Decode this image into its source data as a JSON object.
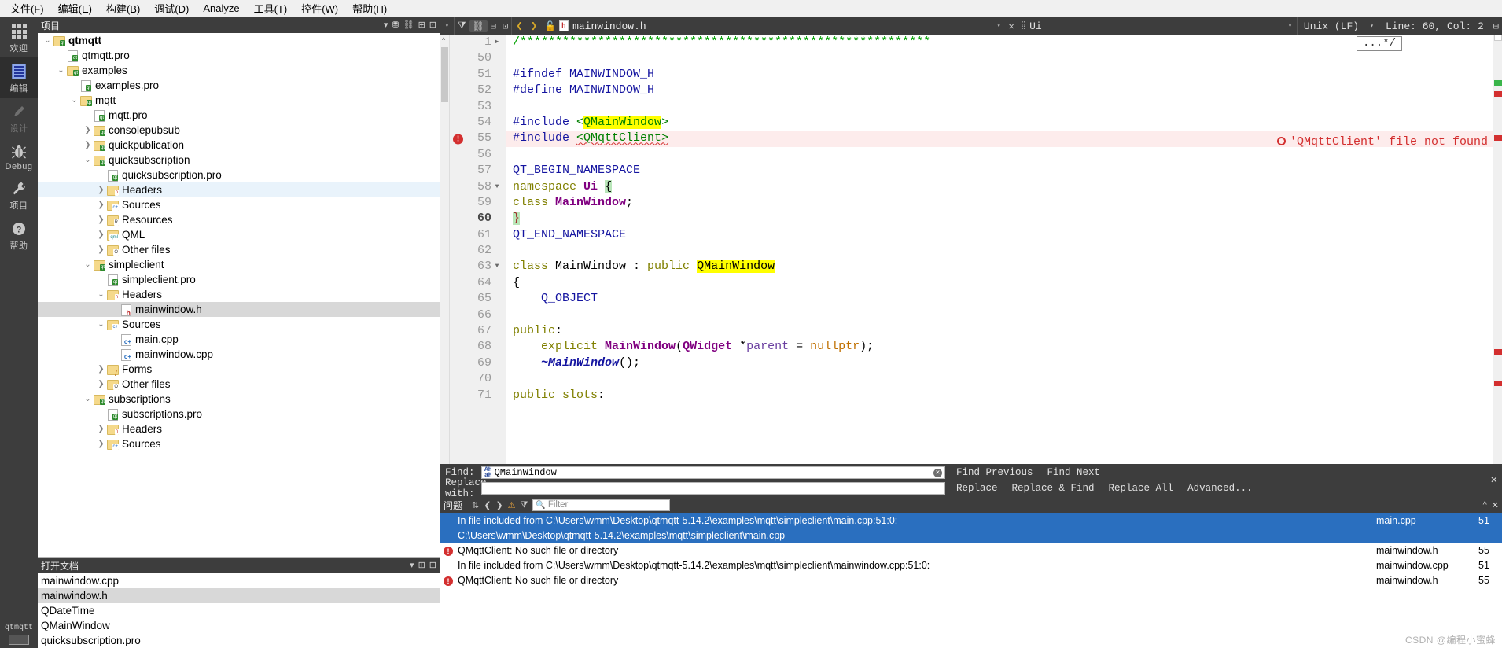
{
  "menubar": [
    {
      "label": "文件(F)"
    },
    {
      "label": "编辑(E)"
    },
    {
      "label": "构建(B)"
    },
    {
      "label": "调试(D)"
    },
    {
      "label": "Analyze"
    },
    {
      "label": "工具(T)"
    },
    {
      "label": "控件(W)"
    },
    {
      "label": "帮助(H)"
    }
  ],
  "modebar": {
    "items": [
      {
        "label": "欢迎",
        "icon": "grid-icon",
        "state": "normal"
      },
      {
        "label": "编辑",
        "icon": "document-icon",
        "state": "selected"
      },
      {
        "label": "设计",
        "icon": "pencil-icon",
        "state": "disabled"
      },
      {
        "label": "Debug",
        "icon": "bug-icon",
        "state": "normal"
      },
      {
        "label": "项目",
        "icon": "wrench-icon",
        "state": "normal"
      },
      {
        "label": "帮助",
        "icon": "question-icon",
        "state": "normal"
      }
    ],
    "project_name": "qtmqtt"
  },
  "project_panel": {
    "title": "项目",
    "tree": [
      {
        "indent": 0,
        "arrow": "down",
        "icon": "folder",
        "tag": "qt",
        "label": "qtmqtt",
        "bold": true,
        "sel": ""
      },
      {
        "indent": 1,
        "arrow": "none",
        "icon": "file",
        "tag": "qt",
        "label": "qtmqtt.pro",
        "bold": false,
        "sel": ""
      },
      {
        "indent": 1,
        "arrow": "down",
        "icon": "folder",
        "tag": "qt",
        "label": "examples",
        "bold": false,
        "sel": ""
      },
      {
        "indent": 2,
        "arrow": "none",
        "icon": "file",
        "tag": "qt",
        "label": "examples.pro",
        "bold": false,
        "sel": ""
      },
      {
        "indent": 2,
        "arrow": "down",
        "icon": "folder",
        "tag": "qt",
        "label": "mqtt",
        "bold": false,
        "sel": ""
      },
      {
        "indent": 3,
        "arrow": "none",
        "icon": "file",
        "tag": "qt",
        "label": "mqtt.pro",
        "bold": false,
        "sel": ""
      },
      {
        "indent": 3,
        "arrow": "right",
        "icon": "folder",
        "tag": "qt",
        "label": "consolepubsub",
        "bold": false,
        "sel": ""
      },
      {
        "indent": 3,
        "arrow": "right",
        "icon": "folder",
        "tag": "qt",
        "label": "quickpublication",
        "bold": false,
        "sel": ""
      },
      {
        "indent": 3,
        "arrow": "down",
        "icon": "folder",
        "tag": "qt",
        "label": "quicksubscription",
        "bold": false,
        "sel": ""
      },
      {
        "indent": 4,
        "arrow": "none",
        "icon": "file",
        "tag": "qt",
        "label": "quicksubscription.pro",
        "bold": false,
        "sel": ""
      },
      {
        "indent": 4,
        "arrow": "right",
        "icon": "folder-h",
        "tag": "h",
        "label": "Headers",
        "bold": false,
        "sel": "blue"
      },
      {
        "indent": 4,
        "arrow": "right",
        "icon": "folder-cpp",
        "tag": "c+",
        "label": "Sources",
        "bold": false,
        "sel": ""
      },
      {
        "indent": 4,
        "arrow": "right",
        "icon": "folder-res",
        "tag": "R",
        "label": "Resources",
        "bold": false,
        "sel": ""
      },
      {
        "indent": 4,
        "arrow": "right",
        "icon": "folder-qml",
        "tag": "qml",
        "label": "QML",
        "bold": false,
        "sel": ""
      },
      {
        "indent": 4,
        "arrow": "right",
        "icon": "folder-other",
        "tag": "O",
        "label": "Other files",
        "bold": false,
        "sel": ""
      },
      {
        "indent": 3,
        "arrow": "down",
        "icon": "folder",
        "tag": "qt",
        "label": "simpleclient",
        "bold": false,
        "sel": ""
      },
      {
        "indent": 4,
        "arrow": "none",
        "icon": "file",
        "tag": "qt",
        "label": "simpleclient.pro",
        "bold": false,
        "sel": ""
      },
      {
        "indent": 4,
        "arrow": "down",
        "icon": "folder-h",
        "tag": "h",
        "label": "Headers",
        "bold": false,
        "sel": ""
      },
      {
        "indent": 5,
        "arrow": "none",
        "icon": "file-h",
        "tag": "h",
        "label": "mainwindow.h",
        "bold": false,
        "sel": "gray"
      },
      {
        "indent": 4,
        "arrow": "down",
        "icon": "folder-cpp",
        "tag": "c+",
        "label": "Sources",
        "bold": false,
        "sel": ""
      },
      {
        "indent": 5,
        "arrow": "none",
        "icon": "file-cpp",
        "tag": "c+",
        "label": "main.cpp",
        "bold": false,
        "sel": ""
      },
      {
        "indent": 5,
        "arrow": "none",
        "icon": "file-cpp",
        "tag": "c+",
        "label": "mainwindow.cpp",
        "bold": false,
        "sel": ""
      },
      {
        "indent": 4,
        "arrow": "right",
        "icon": "folder-forms",
        "tag": "F",
        "label": "Forms",
        "bold": false,
        "sel": ""
      },
      {
        "indent": 4,
        "arrow": "right",
        "icon": "folder-other",
        "tag": "O",
        "label": "Other files",
        "bold": false,
        "sel": ""
      },
      {
        "indent": 3,
        "arrow": "down",
        "icon": "folder",
        "tag": "qt",
        "label": "subscriptions",
        "bold": false,
        "sel": ""
      },
      {
        "indent": 4,
        "arrow": "none",
        "icon": "file",
        "tag": "qt",
        "label": "subscriptions.pro",
        "bold": false,
        "sel": ""
      },
      {
        "indent": 4,
        "arrow": "right",
        "icon": "folder-h",
        "tag": "h",
        "label": "Headers",
        "bold": false,
        "sel": ""
      },
      {
        "indent": 4,
        "arrow": "right",
        "icon": "folder-cpp",
        "tag": "c+",
        "label": "Sources",
        "bold": false,
        "sel": ""
      }
    ]
  },
  "open_documents": {
    "title": "打开文档",
    "items": [
      {
        "label": "mainwindow.cpp",
        "sel": false
      },
      {
        "label": "mainwindow.h",
        "sel": true
      },
      {
        "label": "QDateTime",
        "sel": false
      },
      {
        "label": "QMainWindow",
        "sel": false
      },
      {
        "label": "quicksubscription.pro",
        "sel": false
      }
    ]
  },
  "editor_toolbar": {
    "filename": "mainwindow.h",
    "symbol": "Ui",
    "line_ending": "Unix (LF)",
    "cursor": "Line: 60, Col: 2"
  },
  "editor": {
    "fold_preview": "...*/",
    "error_annotation": "'QMqttClient' file not found",
    "lines": [
      {
        "num": "1",
        "fold": "right",
        "marker": "",
        "current": false,
        "error": false,
        "changed": false,
        "html": "<span class='cmt'>/**********************************************************</span>"
      },
      {
        "num": "50",
        "fold": "",
        "marker": "",
        "current": false,
        "error": false,
        "changed": false,
        "html": ""
      },
      {
        "num": "51",
        "fold": "",
        "marker": "",
        "current": false,
        "error": false,
        "changed": false,
        "html": "<span class='pre'>#ifndef MAINWINDOW_H</span>"
      },
      {
        "num": "52",
        "fold": "",
        "marker": "",
        "current": false,
        "error": false,
        "changed": false,
        "html": "<span class='pre'>#define MAINWINDOW_H</span>"
      },
      {
        "num": "53",
        "fold": "",
        "marker": "",
        "current": false,
        "error": false,
        "changed": false,
        "html": ""
      },
      {
        "num": "54",
        "fold": "",
        "marker": "",
        "current": false,
        "error": false,
        "changed": true,
        "html": "<span class='pre'>#include </span><span class='str'>&lt;</span><span class='str hl'>QMainWindow</span><span class='str'>&gt;</span>"
      },
      {
        "num": "55",
        "fold": "",
        "marker": "error",
        "current": false,
        "error": true,
        "changed": true,
        "html": "<span class='pre'>#include </span><span class='str uline'>&lt;QMqttClient&gt;</span>"
      },
      {
        "num": "56",
        "fold": "",
        "marker": "",
        "current": false,
        "error": false,
        "changed": false,
        "html": ""
      },
      {
        "num": "57",
        "fold": "",
        "marker": "",
        "current": false,
        "error": false,
        "changed": false,
        "html": "<span class='kw'>QT_BEGIN_NAMESPACE</span>"
      },
      {
        "num": "58",
        "fold": "down",
        "marker": "",
        "current": false,
        "error": false,
        "changed": false,
        "html": "<span class='typ'>namespace</span> <span class='cls'>Ui</span> <span class='greenhl'>{</span>"
      },
      {
        "num": "59",
        "fold": "",
        "marker": "",
        "current": false,
        "error": false,
        "changed": false,
        "html": "<span class='typ'>class</span> <span class='cls'>MainWindow</span>;"
      },
      {
        "num": "60",
        "fold": "",
        "marker": "",
        "current": true,
        "error": false,
        "changed": false,
        "html": "<span class='greenhl' style='color:#a03030'>}</span>"
      },
      {
        "num": "61",
        "fold": "",
        "marker": "",
        "current": false,
        "error": false,
        "changed": false,
        "html": "<span class='kw'>QT_END_NAMESPACE</span>"
      },
      {
        "num": "62",
        "fold": "",
        "marker": "",
        "current": false,
        "error": false,
        "changed": false,
        "html": ""
      },
      {
        "num": "63",
        "fold": "down",
        "marker": "",
        "current": false,
        "error": false,
        "changed": false,
        "html": "<span class='typ'>class</span> MainWindow : <span class='typ'>public</span> <span class='hl'>QMainWindow</span>"
      },
      {
        "num": "64",
        "fold": "",
        "marker": "",
        "current": false,
        "error": false,
        "changed": false,
        "html": "{"
      },
      {
        "num": "65",
        "fold": "",
        "marker": "",
        "current": false,
        "error": false,
        "changed": false,
        "html": "    <span class='kw'>Q_OBJECT</span>"
      },
      {
        "num": "66",
        "fold": "",
        "marker": "",
        "current": false,
        "error": false,
        "changed": false,
        "html": ""
      },
      {
        "num": "67",
        "fold": "",
        "marker": "",
        "current": false,
        "error": false,
        "changed": false,
        "html": "<span class='typ'>public</span>:"
      },
      {
        "num": "68",
        "fold": "",
        "marker": "",
        "current": false,
        "error": false,
        "changed": false,
        "html": "    <span class='typ'>explicit</span> <span class='cls'>MainWindow</span>(<span class='cls'>QWidget</span> *<span style='color:#6a3fa0'>parent</span> = <span class='num2'>nullptr</span>);"
      },
      {
        "num": "69",
        "fold": "",
        "marker": "",
        "current": false,
        "error": false,
        "changed": false,
        "html": "    <span style='color:#1414a0;font-style:italic;font-weight:bold'>~MainWindow</span>();"
      },
      {
        "num": "70",
        "fold": "",
        "marker": "",
        "current": false,
        "error": false,
        "changed": false,
        "html": ""
      },
      {
        "num": "71",
        "fold": "",
        "marker": "",
        "current": false,
        "error": false,
        "changed": false,
        "html": "<span class='typ'>public slots</span>:"
      }
    ]
  },
  "find_bar": {
    "find_label": "Find:",
    "find_value": "QMainWindow",
    "replace_label": "Replace with:",
    "replace_value": "",
    "buttons_row1": [
      "Find Previous",
      "Find Next"
    ],
    "buttons_row2": [
      "Replace",
      "Replace & Find",
      "Replace All",
      "Advanced..."
    ]
  },
  "issues": {
    "title": "问题",
    "filter_placeholder": "Filter",
    "rows": [
      {
        "badge": "",
        "text": "In file included from C:\\Users\\wmm\\Desktop\\qtmqtt-5.14.2\\examples\\mqtt\\simpleclient\\main.cpp:51:0:",
        "file": "main.cpp",
        "line": "51",
        "sel": true
      },
      {
        "badge": "",
        "text": "C:\\Users\\wmm\\Desktop\\qtmqtt-5.14.2\\examples\\mqtt\\simpleclient\\main.cpp",
        "file": "",
        "line": "",
        "sel": true
      },
      {
        "badge": "error",
        "text": "QMqttClient: No such file or directory",
        "file": "mainwindow.h",
        "line": "55",
        "sel": false
      },
      {
        "badge": "",
        "text": "In file included from C:\\Users\\wmm\\Desktop\\qtmqtt-5.14.2\\examples\\mqtt\\simpleclient\\mainwindow.cpp:51:0:",
        "file": "mainwindow.cpp",
        "line": "51",
        "sel": false
      },
      {
        "badge": "error",
        "text": "QMqttClient: No such file or directory",
        "file": "mainwindow.h",
        "line": "55",
        "sel": false
      }
    ],
    "watermark": "CSDN @编程小蜜蜂"
  },
  "colors": {
    "dark_chrome": "#3d3d3d",
    "accent_blue": "#2a6fbf",
    "error_red": "#d32f2f",
    "highlight_yellow": "#ffff00"
  }
}
